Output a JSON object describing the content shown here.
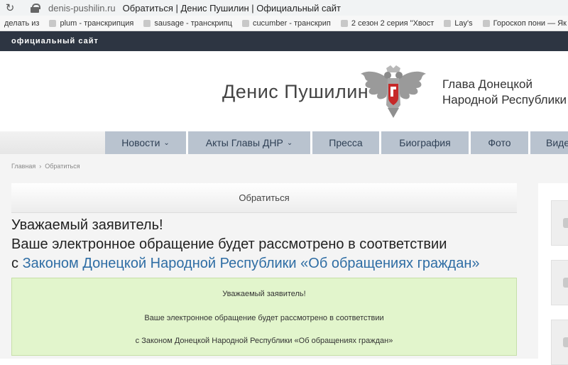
{
  "browser": {
    "reload_icon": "reload-icon",
    "domain": "denis-pushilin.ru",
    "page_title": "Обратиться | Денис Пушилин | Официальный сайт",
    "bookmarks": [
      "делать из",
      "plum - транскрипция",
      "sausage - транскрипц",
      "cucumber - транскрип",
      "2 сезон 2 серия \"Хвост",
      "Lay's",
      "Гороскоп пони — Як"
    ]
  },
  "site": {
    "top_label": "официальный сайт",
    "person_name": "Денис Пушилин",
    "role_line1": "Глава Донецкой",
    "role_line2": "Народной Республики",
    "colors": {
      "top_strip": "#2d3542",
      "nav_item": "#b9c3cf",
      "link": "#2e6da4",
      "notice_bg": "#e2f5cc"
    }
  },
  "nav": [
    {
      "label": "Новости",
      "dropdown": true
    },
    {
      "label": "Акты Главы ДНР",
      "dropdown": true
    },
    {
      "label": "Пресса",
      "dropdown": false
    },
    {
      "label": "Биография",
      "dropdown": false
    },
    {
      "label": "Фото",
      "dropdown": false
    },
    {
      "label": "Виде",
      "dropdown": false
    }
  ],
  "breadcrumb": {
    "home": "Главная",
    "separator": "›",
    "current": "Обратиться"
  },
  "page": {
    "heading": "Обратиться",
    "intro_line1": "Уважаемый заявитель!",
    "intro_line2": "Ваше электронное обращение будет рассмотрено в соответствии",
    "intro_prefix": "с",
    "intro_link": "Законом Донецкой Народной Республики «Об обращениях граждан»"
  },
  "notice": {
    "line1": "Уважаемый заявитель!",
    "line2": "Ваше электронное обращение будет рассмотрено в соответствии",
    "line3": "с Законом Донецкой Народной Республики «Об обращениях граждан»"
  }
}
